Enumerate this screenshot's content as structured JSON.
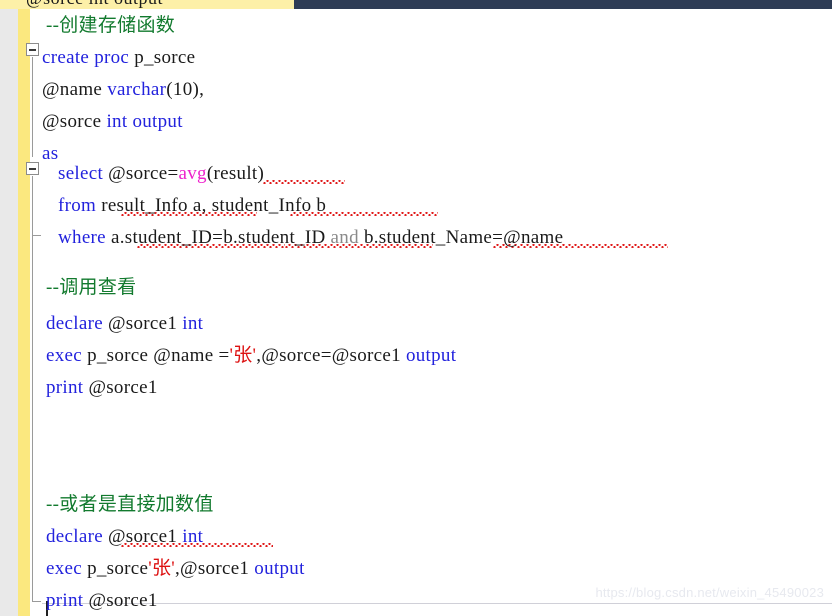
{
  "app": {
    "kind": "sql-code-editor",
    "watermark": "https://blog.csdn.net/weixin_45490023"
  },
  "gutter": {
    "change_bar_color": "#fbe87f",
    "margin_color": "#e9e9e9",
    "fold_boxes": [
      {
        "name": "fold-create-proc",
        "state": "expanded",
        "glyph": "minus"
      },
      {
        "name": "fold-select-block",
        "state": "expanded",
        "glyph": "minus"
      }
    ]
  },
  "top_clipped_line": {
    "text": "@sorce int output",
    "selection_color": "#2e3c55",
    "change_color": "#fdf0a8"
  },
  "colors": {
    "keyword": "#2222dd",
    "function": "#ee22cc",
    "string": "#dd1111",
    "comment": "#127a2e",
    "operator": "#1a1a1a",
    "dimmed": "#8a8a8a",
    "squiggle": "#e01b1b",
    "background": "#ffffff"
  },
  "code": {
    "lines": [
      {
        "name": "line-comment-create",
        "tokens": [
          {
            "t": "--创建存储函数",
            "c": "cmt"
          }
        ]
      },
      {
        "name": "line-create-proc",
        "tokens": [
          {
            "t": "create proc ",
            "c": "kw"
          },
          {
            "t": "p_sorce",
            "c": "plain"
          }
        ]
      },
      {
        "name": "line-param-name",
        "tokens": [
          {
            "t": "@name ",
            "c": "plain"
          },
          {
            "t": "varchar",
            "c": "kw"
          },
          {
            "t": "(10),",
            "c": "plain"
          }
        ]
      },
      {
        "name": "line-param-sorce",
        "tokens": [
          {
            "t": "@sorce ",
            "c": "plain"
          },
          {
            "t": "int output",
            "c": "kw"
          }
        ]
      },
      {
        "name": "line-as",
        "tokens": [
          {
            "t": "as",
            "c": "kw"
          }
        ]
      },
      {
        "name": "line-select",
        "tokens": [
          {
            "t": "select ",
            "c": "kw"
          },
          {
            "t": "@sorce=",
            "c": "plain"
          },
          {
            "t": "avg",
            "c": "fn"
          },
          {
            "t": "(result)",
            "c": "plain"
          }
        ]
      },
      {
        "name": "line-from",
        "tokens": [
          {
            "t": "from ",
            "c": "kw"
          },
          {
            "t": "result_Info a, student_Info b",
            "c": "plain"
          }
        ]
      },
      {
        "name": "line-where",
        "tokens": [
          {
            "t": "where ",
            "c": "kw"
          },
          {
            "t": "a.student_ID=b.student_ID ",
            "c": "plain"
          },
          {
            "t": "and ",
            "c": "dim"
          },
          {
            "t": "b.student_Name=@name",
            "c": "plain"
          }
        ]
      },
      {
        "name": "line-comment-call",
        "tokens": [
          {
            "t": "--调用查看",
            "c": "cmt"
          }
        ]
      },
      {
        "name": "line-declare-1",
        "tokens": [
          {
            "t": "declare ",
            "c": "kw"
          },
          {
            "t": "@sorce1 ",
            "c": "plain"
          },
          {
            "t": "int",
            "c": "kw"
          }
        ]
      },
      {
        "name": "line-exec-1",
        "tokens": [
          {
            "t": "exec ",
            "c": "kw"
          },
          {
            "t": "p_sorce @name =",
            "c": "plain"
          },
          {
            "t": "'张'",
            "c": "str"
          },
          {
            "t": ",@sorce=@sorce1 ",
            "c": "plain"
          },
          {
            "t": "output",
            "c": "kw"
          }
        ]
      },
      {
        "name": "line-print-1",
        "tokens": [
          {
            "t": "print ",
            "c": "kw"
          },
          {
            "t": "@sorce1",
            "c": "plain"
          }
        ]
      },
      {
        "name": "line-comment-direct",
        "tokens": [
          {
            "t": "--或者是直接加数值",
            "c": "cmt"
          }
        ]
      },
      {
        "name": "line-declare-2",
        "tokens": [
          {
            "t": "declare ",
            "c": "kw"
          },
          {
            "t": "@sorce1 ",
            "c": "plain"
          },
          {
            "t": "int",
            "c": "kw"
          }
        ]
      },
      {
        "name": "line-exec-2",
        "tokens": [
          {
            "t": "exec ",
            "c": "kw"
          },
          {
            "t": "p_sorce",
            "c": "plain"
          },
          {
            "t": "'张'",
            "c": "str"
          },
          {
            "t": ",@sorce1 ",
            "c": "plain"
          },
          {
            "t": "output",
            "c": "kw"
          }
        ]
      },
      {
        "name": "line-print-2",
        "tokens": [
          {
            "t": "print ",
            "c": "kw"
          },
          {
            "t": "@sorce1",
            "c": "plain"
          }
        ]
      }
    ]
  }
}
